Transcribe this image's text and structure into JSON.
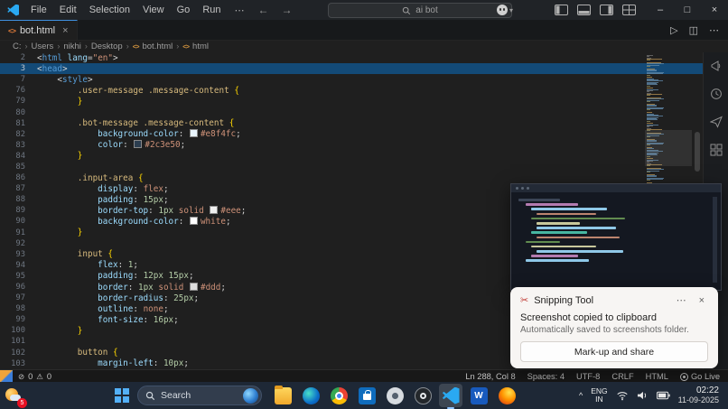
{
  "title_bar": {
    "menus": [
      "File",
      "Edit",
      "Selection",
      "View",
      "Go",
      "Run"
    ],
    "overflow": "⋯",
    "back": "←",
    "forward": "→",
    "search_text": "ai bot",
    "copilot_chevron": "▾",
    "window": {
      "minimize": "–",
      "maximize": "□",
      "close": "×"
    }
  },
  "tab_bar": {
    "tab": {
      "label": "bot.html",
      "icon": "<>",
      "close": "×"
    },
    "actions": {
      "run": "▷",
      "split": "◫",
      "more": "⋯"
    }
  },
  "breadcrumb": {
    "items": [
      "C:",
      "Users",
      "nikhi",
      "Desktop",
      "bot.html",
      "html"
    ],
    "separator": "›",
    "code_icon": "<>"
  },
  "editor": {
    "lines": [
      {
        "n": "2",
        "tokens": [
          {
            "c": "punc",
            "t": "<"
          },
          {
            "c": "tag",
            "t": "html"
          },
          {
            "c": "ws",
            "t": " "
          },
          {
            "c": "attr",
            "t": "lang"
          },
          {
            "c": "punc",
            "t": "="
          },
          {
            "c": "str",
            "t": "\"en\""
          },
          {
            "c": "punc",
            "t": ">"
          }
        ]
      },
      {
        "n": "3",
        "hl": true,
        "tokens": [
          {
            "c": "punc",
            "t": "<"
          },
          {
            "c": "tag",
            "t": "head"
          },
          {
            "c": "punc",
            "t": ">"
          }
        ]
      },
      {
        "n": "7",
        "tokens": [
          {
            "c": "ws",
            "t": "    "
          },
          {
            "c": "punc",
            "t": "<"
          },
          {
            "c": "tag",
            "t": "style"
          },
          {
            "c": "punc",
            "t": ">"
          }
        ]
      },
      {
        "n": "76",
        "tokens": [
          {
            "c": "ws",
            "t": "        "
          },
          {
            "c": "sel",
            "t": ".user-message .message-content"
          },
          {
            "c": "ws",
            "t": " "
          },
          {
            "c": "brace",
            "t": "{"
          }
        ]
      },
      {
        "n": "79",
        "tokens": [
          {
            "c": "ws",
            "t": "        "
          },
          {
            "c": "brace",
            "t": "}"
          }
        ]
      },
      {
        "n": "80",
        "tokens": []
      },
      {
        "n": "81",
        "tokens": [
          {
            "c": "ws",
            "t": "        "
          },
          {
            "c": "sel",
            "t": ".bot-message .message-content"
          },
          {
            "c": "ws",
            "t": " "
          },
          {
            "c": "brace",
            "t": "{"
          }
        ]
      },
      {
        "n": "82",
        "tokens": [
          {
            "c": "ws",
            "t": "            "
          },
          {
            "c": "prop",
            "t": "background-color"
          },
          {
            "c": "punc",
            "t": ": "
          },
          {
            "c": "swatch",
            "t": "#e8f4fc"
          },
          {
            "c": "val",
            "t": "#e8f4fc"
          },
          {
            "c": "punc",
            "t": ";"
          }
        ]
      },
      {
        "n": "83",
        "tokens": [
          {
            "c": "ws",
            "t": "            "
          },
          {
            "c": "prop",
            "t": "color"
          },
          {
            "c": "punc",
            "t": ": "
          },
          {
            "c": "swatch",
            "t": "#2c3e50"
          },
          {
            "c": "val",
            "t": "#2c3e50"
          },
          {
            "c": "punc",
            "t": ";"
          }
        ]
      },
      {
        "n": "84",
        "tokens": [
          {
            "c": "ws",
            "t": "        "
          },
          {
            "c": "brace",
            "t": "}"
          }
        ]
      },
      {
        "n": "85",
        "tokens": []
      },
      {
        "n": "86",
        "tokens": [
          {
            "c": "ws",
            "t": "        "
          },
          {
            "c": "sel",
            "t": ".input-area"
          },
          {
            "c": "ws",
            "t": " "
          },
          {
            "c": "brace",
            "t": "{"
          }
        ]
      },
      {
        "n": "87",
        "tokens": [
          {
            "c": "ws",
            "t": "            "
          },
          {
            "c": "prop",
            "t": "display"
          },
          {
            "c": "punc",
            "t": ": "
          },
          {
            "c": "kw",
            "t": "flex"
          },
          {
            "c": "punc",
            "t": ";"
          }
        ]
      },
      {
        "n": "88",
        "tokens": [
          {
            "c": "ws",
            "t": "            "
          },
          {
            "c": "prop",
            "t": "padding"
          },
          {
            "c": "punc",
            "t": ": "
          },
          {
            "c": "num",
            "t": "15px"
          },
          {
            "c": "punc",
            "t": ";"
          }
        ]
      },
      {
        "n": "89",
        "tokens": [
          {
            "c": "ws",
            "t": "            "
          },
          {
            "c": "prop",
            "t": "border-top"
          },
          {
            "c": "punc",
            "t": ": "
          },
          {
            "c": "num",
            "t": "1px"
          },
          {
            "c": "ws",
            "t": " "
          },
          {
            "c": "kw",
            "t": "solid"
          },
          {
            "c": "ws",
            "t": " "
          },
          {
            "c": "swatch",
            "t": "#eeeeee"
          },
          {
            "c": "val",
            "t": "#eee"
          },
          {
            "c": "punc",
            "t": ";"
          }
        ]
      },
      {
        "n": "90",
        "tokens": [
          {
            "c": "ws",
            "t": "            "
          },
          {
            "c": "prop",
            "t": "background-color"
          },
          {
            "c": "punc",
            "t": ": "
          },
          {
            "c": "swatch",
            "t": "#ffffff"
          },
          {
            "c": "kw",
            "t": "white"
          },
          {
            "c": "punc",
            "t": ";"
          }
        ]
      },
      {
        "n": "91",
        "tokens": [
          {
            "c": "ws",
            "t": "        "
          },
          {
            "c": "brace",
            "t": "}"
          }
        ]
      },
      {
        "n": "92",
        "tokens": []
      },
      {
        "n": "93",
        "tokens": [
          {
            "c": "ws",
            "t": "        "
          },
          {
            "c": "sel",
            "t": "input"
          },
          {
            "c": "ws",
            "t": " "
          },
          {
            "c": "brace",
            "t": "{"
          }
        ]
      },
      {
        "n": "94",
        "tokens": [
          {
            "c": "ws",
            "t": "            "
          },
          {
            "c": "prop",
            "t": "flex"
          },
          {
            "c": "punc",
            "t": ": "
          },
          {
            "c": "num",
            "t": "1"
          },
          {
            "c": "punc",
            "t": ";"
          }
        ]
      },
      {
        "n": "95",
        "tokens": [
          {
            "c": "ws",
            "t": "            "
          },
          {
            "c": "prop",
            "t": "padding"
          },
          {
            "c": "punc",
            "t": ": "
          },
          {
            "c": "num",
            "t": "12px 15px"
          },
          {
            "c": "punc",
            "t": ";"
          }
        ]
      },
      {
        "n": "96",
        "tokens": [
          {
            "c": "ws",
            "t": "            "
          },
          {
            "c": "prop",
            "t": "border"
          },
          {
            "c": "punc",
            "t": ": "
          },
          {
            "c": "num",
            "t": "1px"
          },
          {
            "c": "ws",
            "t": " "
          },
          {
            "c": "kw",
            "t": "solid"
          },
          {
            "c": "ws",
            "t": " "
          },
          {
            "c": "swatch",
            "t": "#dddddd"
          },
          {
            "c": "val",
            "t": "#ddd"
          },
          {
            "c": "punc",
            "t": ";"
          }
        ]
      },
      {
        "n": "97",
        "tokens": [
          {
            "c": "ws",
            "t": "            "
          },
          {
            "c": "prop",
            "t": "border-radius"
          },
          {
            "c": "punc",
            "t": ": "
          },
          {
            "c": "num",
            "t": "25px"
          },
          {
            "c": "punc",
            "t": ";"
          }
        ]
      },
      {
        "n": "98",
        "tokens": [
          {
            "c": "ws",
            "t": "            "
          },
          {
            "c": "prop",
            "t": "outline"
          },
          {
            "c": "punc",
            "t": ": "
          },
          {
            "c": "kw",
            "t": "none"
          },
          {
            "c": "punc",
            "t": ";"
          }
        ]
      },
      {
        "n": "99",
        "tokens": [
          {
            "c": "ws",
            "t": "            "
          },
          {
            "c": "prop",
            "t": "font-size"
          },
          {
            "c": "punc",
            "t": ": "
          },
          {
            "c": "num",
            "t": "16px"
          },
          {
            "c": "punc",
            "t": ";"
          }
        ]
      },
      {
        "n": "100",
        "tokens": [
          {
            "c": "ws",
            "t": "        "
          },
          {
            "c": "brace",
            "t": "}"
          }
        ]
      },
      {
        "n": "101",
        "tokens": []
      },
      {
        "n": "102",
        "tokens": [
          {
            "c": "ws",
            "t": "        "
          },
          {
            "c": "sel",
            "t": "button"
          },
          {
            "c": "ws",
            "t": " "
          },
          {
            "c": "brace",
            "t": "{"
          }
        ]
      },
      {
        "n": "103",
        "tokens": [
          {
            "c": "ws",
            "t": "            "
          },
          {
            "c": "prop",
            "t": "margin-left"
          },
          {
            "c": "punc",
            "t": ": "
          },
          {
            "c": "num",
            "t": "10px"
          },
          {
            "c": "punc",
            "t": ";"
          }
        ]
      }
    ]
  },
  "right_rail_icons": [
    "megaphone",
    "history",
    "send",
    "extensions"
  ],
  "status_bar": {
    "errors": "0",
    "warnings": "0",
    "error_glyph": "⊘",
    "warning_glyph": "⚠",
    "items_right": [
      "Ln 288, Col 8",
      "Spaces: 4",
      "UTF-8",
      "CRLF",
      "HTML",
      "Go Live"
    ]
  },
  "notification": {
    "app_name": "Snipping Tool",
    "icon": "✂",
    "more": "⋯",
    "close": "×",
    "message": "Screenshot copied to clipboard",
    "submessage": "Automatically saved to screenshots folder.",
    "action": "Mark-up and share"
  },
  "screenshot_preview": {
    "bars": [
      [
        "#3f4a5c",
        46,
        0
      ],
      [
        "#c586c0",
        58,
        8
      ],
      [
        "#9cdcfe",
        84,
        14
      ],
      [
        "#ce9178",
        66,
        20
      ],
      [
        "#6a9955",
        104,
        14
      ],
      [
        "#dcdcaa",
        48,
        20
      ],
      [
        "#9cdcfe",
        88,
        20
      ],
      [
        "#4ec9b0",
        62,
        14
      ],
      [
        "#ce9178",
        92,
        20
      ],
      [
        "#6a9955",
        38,
        8
      ],
      [
        "#dcdcaa",
        72,
        14
      ],
      [
        "#9cdcfe",
        96,
        20
      ],
      [
        "#c586c0",
        52,
        14
      ],
      [
        "#9cdcfe",
        70,
        8
      ]
    ]
  },
  "taskbar": {
    "badge": "5",
    "search_label": "Search",
    "caret": "^",
    "apps": [
      {
        "name": "file-explorer"
      },
      {
        "name": "edge"
      },
      {
        "name": "chrome"
      },
      {
        "name": "store"
      },
      {
        "name": "snipping"
      },
      {
        "name": "obs"
      },
      {
        "name": "vscode",
        "active": true
      },
      {
        "name": "word",
        "letter": "W"
      },
      {
        "name": "firefox"
      }
    ],
    "tray": {
      "lang1": "ENG",
      "lang2": "IN",
      "time": "02:22",
      "date": "11-09-2025"
    }
  }
}
